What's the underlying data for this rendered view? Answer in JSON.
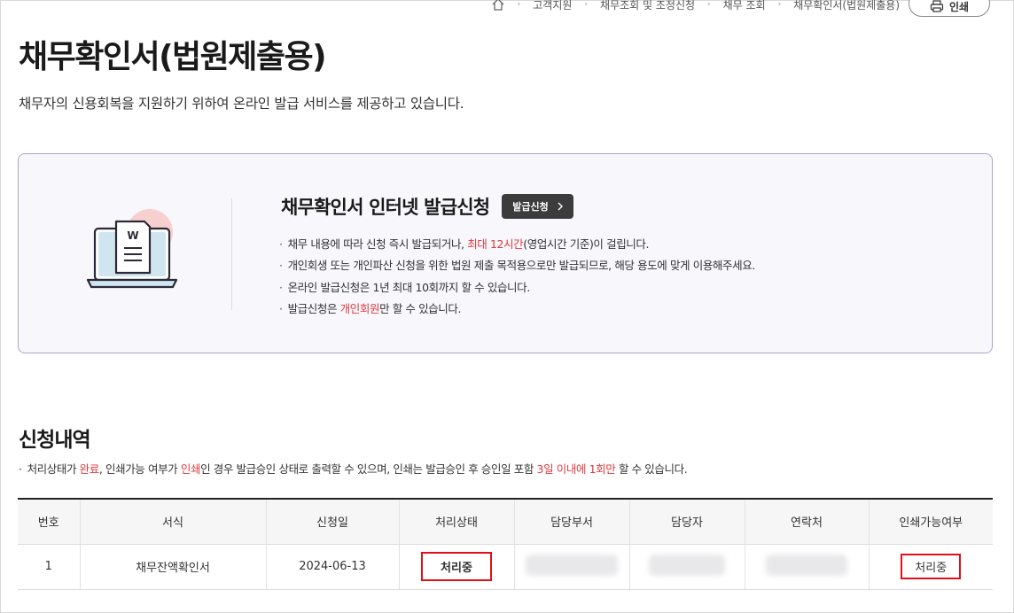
{
  "breadcrumb": {
    "items": [
      "고객지원",
      "채무조회 및 조정신청",
      "채무 조회",
      "채무확인서(법원제출용)"
    ]
  },
  "print_button": {
    "label": "인쇄"
  },
  "page": {
    "title": "채무확인서(법원제출용)",
    "description": "채무자의 신용회복을 지원하기 위하여 온라인 발급 서비스를 제공하고 있습니다."
  },
  "info_box": {
    "illustration_letter": "W",
    "title": "채무확인서 인터넷 발급신청",
    "apply_button": "발급신청",
    "notes": [
      {
        "pre": "채무 내용에 따라 신청 즉시 발급되거나, ",
        "hl": "최대 12시간",
        "post": "(영업시간 기준)이 걸립니다."
      },
      {
        "pre": "개인회생 또는 개인파산 신청을 위한 법원 제출 목적용으로만 발급되므로, 해당 용도에 맞게 이용해주세요.",
        "hl": "",
        "post": ""
      },
      {
        "pre": "온라인 발급신청은 1년 최대 10회까지 할 수 있습니다.",
        "hl": "",
        "post": ""
      },
      {
        "pre": "발급신청은 ",
        "hl": "개인회원",
        "post": "만 할 수 있습니다."
      }
    ]
  },
  "history": {
    "title": "신청내역",
    "note": {
      "p1": "처리상태가 ",
      "h1": "완료",
      "p2": ", 인쇄가능 여부가 ",
      "h2": "인쇄",
      "p3": "인 경우 발급승인 상태로 출력할 수 있으며, 인쇄는 발급승인 후 승인일 포함 ",
      "h3": "3일 이내에 1회만",
      "p4": " 할 수 있습니다."
    },
    "columns": [
      "번호",
      "서식",
      "신청일",
      "처리상태",
      "담당부서",
      "담당자",
      "연락처",
      "인쇄가능여부"
    ],
    "rows": [
      {
        "no": "1",
        "form": "채무잔액확인서",
        "date": "2024-06-13",
        "status": "처리중",
        "print_available": "처리중"
      }
    ]
  },
  "colors": {
    "accent_red": "#e0393e",
    "highlight_box": "#e0101a",
    "box_border": "#a8a8cc"
  }
}
